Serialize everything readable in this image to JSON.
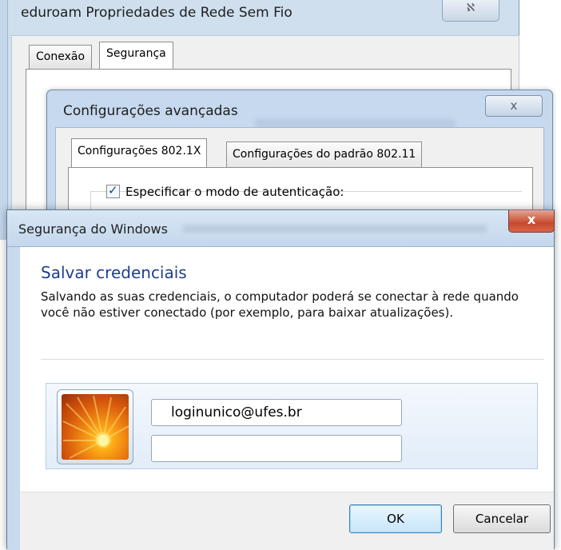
{
  "properties_window": {
    "title": "eduroam Propriedades de Rede Sem Fio",
    "close_glyph": "ℵ",
    "tabs": [
      {
        "label": "Conexão",
        "active": false
      },
      {
        "label": "Segurança",
        "active": true
      }
    ]
  },
  "advanced_window": {
    "title": "Configurações avançadas",
    "close_glyph": "ⅹ",
    "tabs": [
      {
        "label": "Configurações 802.1X",
        "active": true
      },
      {
        "label": "Configurações do padrão 802.11",
        "active": false
      }
    ],
    "auth_mode_checkbox": {
      "label": "Especificar o modo de autenticação:",
      "checked": true
    }
  },
  "security_dialog": {
    "title": "Segurança do Windows",
    "close_glyph": "x",
    "heading": "Salvar credenciais",
    "description": "Salvando as suas credenciais, o computador poderá se conectar à rede quando você não estiver conectado (por exemplo, para baixar atualizações).",
    "avatar_icon": "flower-avatar-icon",
    "username": "loginunico@ufes.br",
    "password": "",
    "ok_label": "OK",
    "cancel_label": "Cancelar"
  },
  "colors": {
    "heading": "#1e3f8d",
    "titlebar": "#c4d7ec",
    "close_red": "#c64a2f"
  }
}
